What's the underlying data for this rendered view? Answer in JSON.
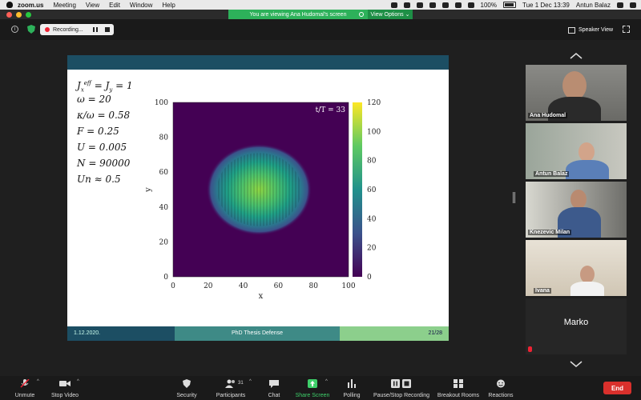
{
  "menubar": {
    "app": "zoom.us",
    "items": [
      "Meeting",
      "View",
      "Edit",
      "Window",
      "Help"
    ],
    "battery": "100%",
    "clock": "Tue 1 Dec  13:39",
    "user": "Antun Balaz"
  },
  "banner": {
    "text": "You are viewing Ana Hudomal's screen",
    "view_options": "View Options"
  },
  "topbar": {
    "recording": "Recording...",
    "speaker_view": "Speaker View"
  },
  "slide": {
    "params": [
      "J_x^eff = J_y = 1",
      "ω = 20",
      "κ/ω = 0.58",
      "F = 0.25",
      "U = 0.005",
      "N = 90000",
      "Un ≈ 0.5"
    ],
    "footer": {
      "date": "1.12.2020.",
      "title": "PhD Thesis Defense",
      "page": "21/28"
    }
  },
  "chart_data": {
    "type": "heatmap",
    "annotation": "t/T = 33",
    "xlabel": "x",
    "ylabel": "y",
    "xlim": [
      0,
      100
    ],
    "ylim": [
      0,
      100
    ],
    "x_ticks": [
      "0",
      "20",
      "40",
      "60",
      "80",
      "100"
    ],
    "y_ticks": [
      "0",
      "20",
      "40",
      "60",
      "80",
      "100"
    ],
    "colorbar": {
      "range": [
        0,
        120
      ],
      "ticks": [
        "0",
        "20",
        "40",
        "60",
        "80",
        "100",
        "120"
      ]
    },
    "blob": {
      "center": [
        49,
        50
      ],
      "radius_x": 24,
      "radius_y": 21,
      "peak": 95
    },
    "colors": {
      "low": "#440154",
      "mid": "#21918c",
      "high": "#fde725"
    }
  },
  "gallery": {
    "participants": [
      "Ana Hudomal",
      "Antun Balaz",
      "Knezevic Milan",
      "Ivana",
      "Marko"
    ],
    "active": "Antun Balaz"
  },
  "toolbar": {
    "unmute": "Unmute",
    "stop_video": "Stop Video",
    "security": "Security",
    "participants": "Participants",
    "participant_count": "31",
    "chat": "Chat",
    "share_screen": "Share Screen",
    "polling": "Polling",
    "pause_stop_recording": "Pause/Stop Recording",
    "breakout_rooms": "Breakout Rooms",
    "reactions": "Reactions",
    "end": "End"
  }
}
